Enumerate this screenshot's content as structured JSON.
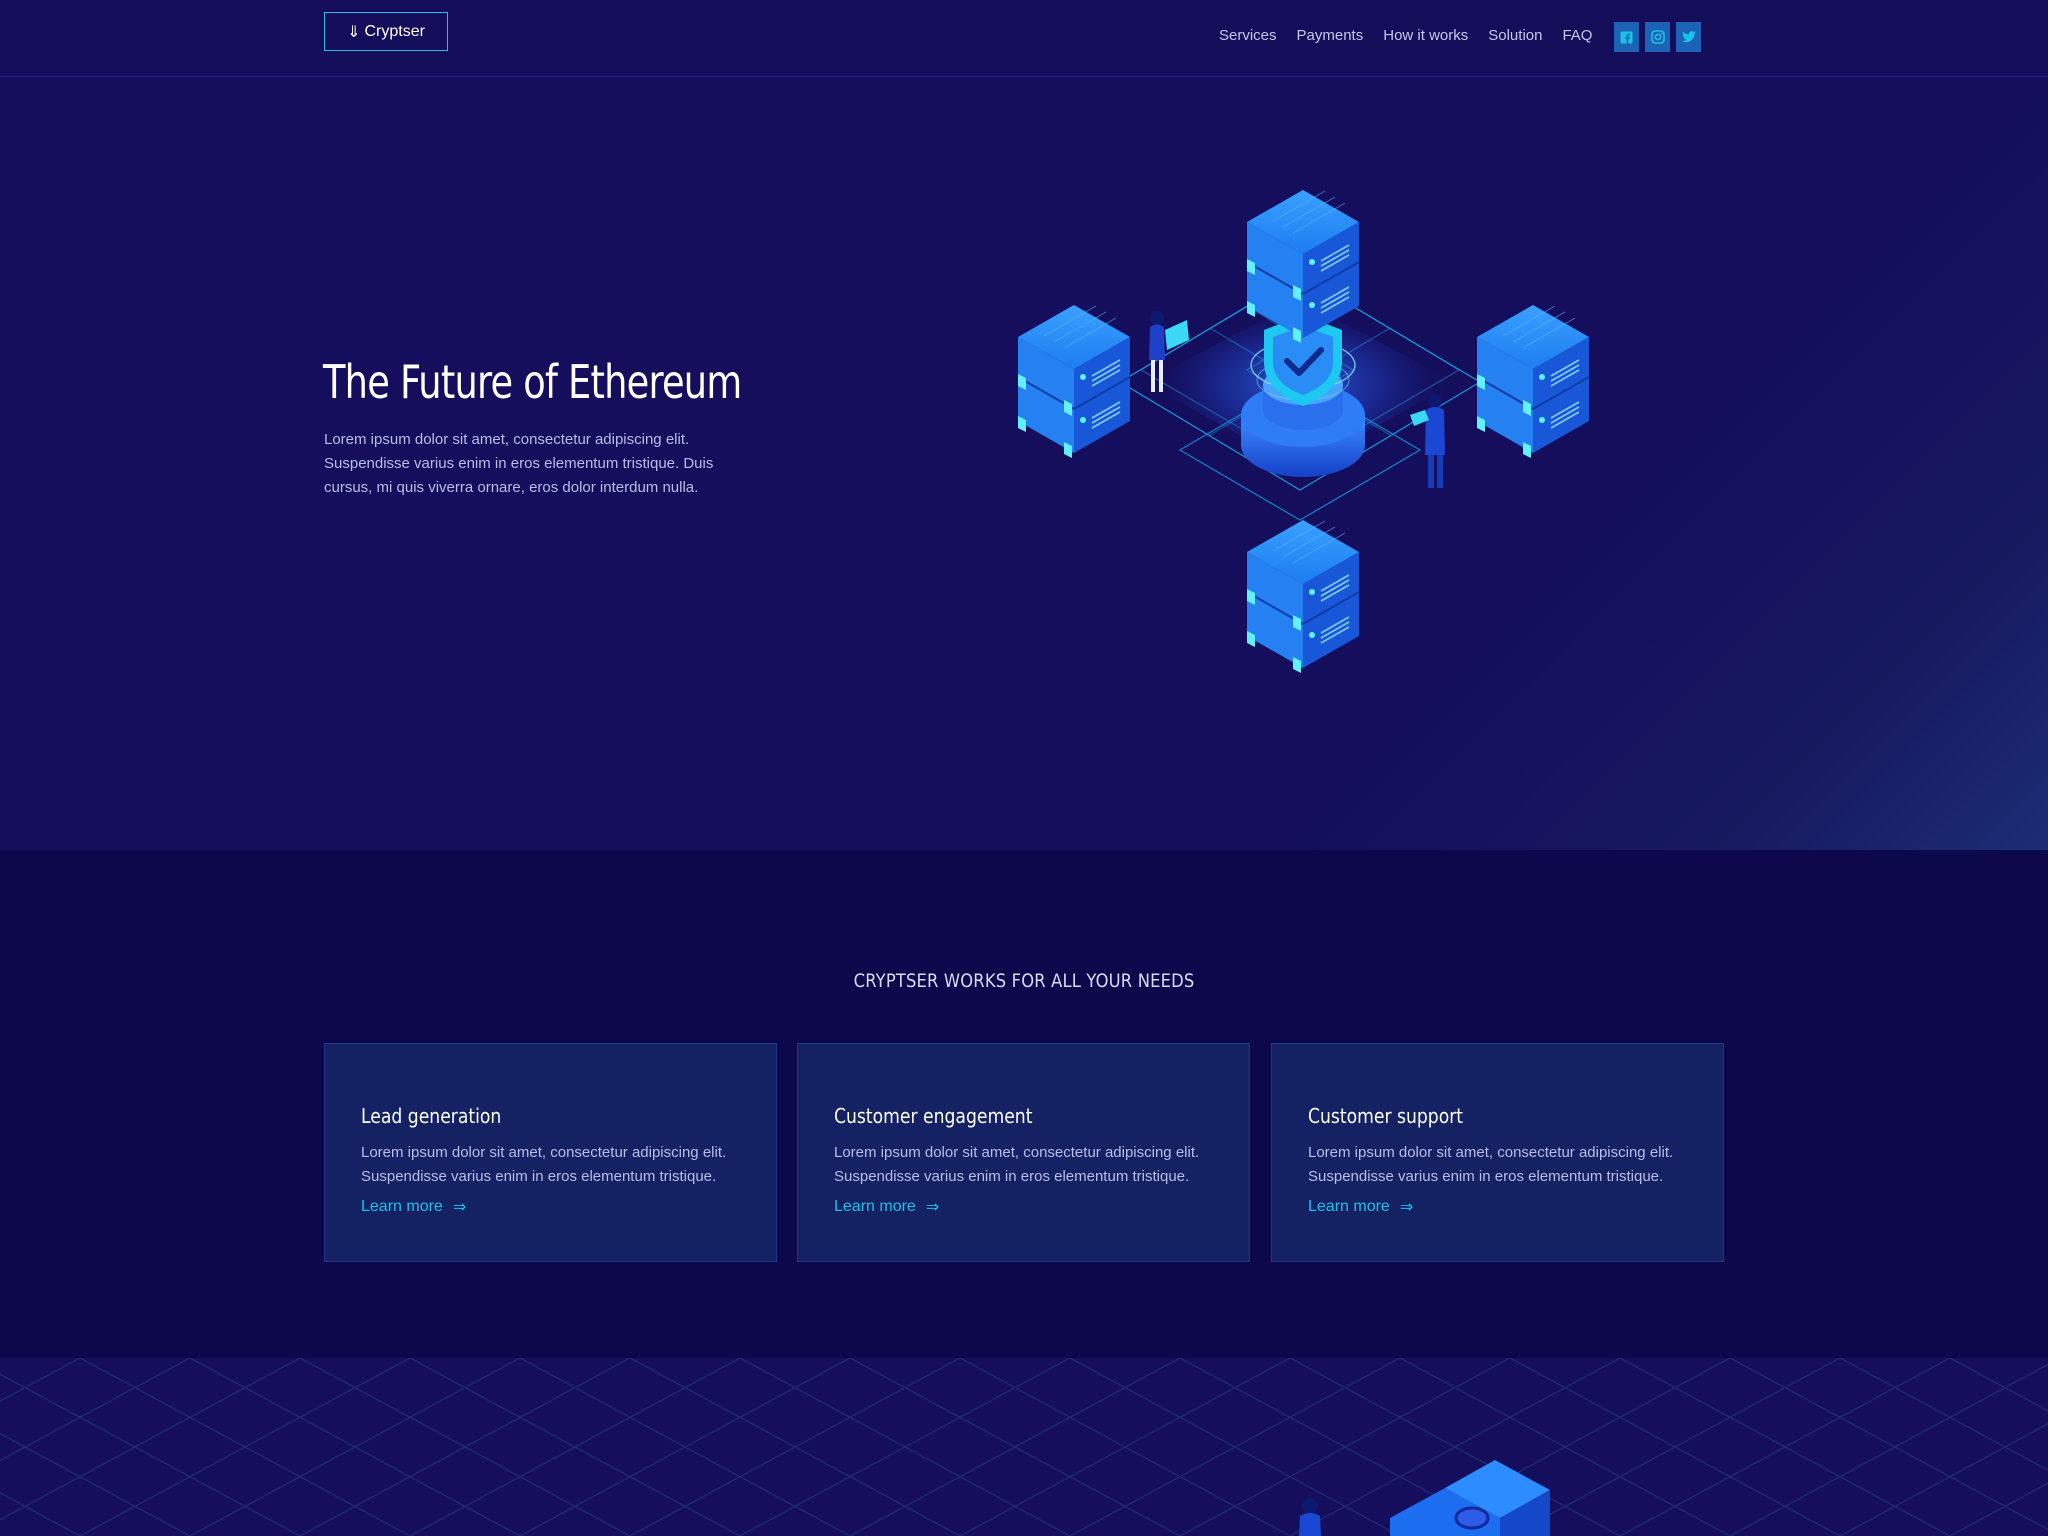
{
  "header": {
    "logo_text": "Cryptser",
    "logo_icon": "down-arrow-icon",
    "nav": [
      "Services",
      "Payments",
      "How it works",
      "Solution",
      "FAQ"
    ],
    "social": [
      "facebook-icon",
      "instagram-icon",
      "twitter-icon"
    ]
  },
  "hero": {
    "title": "The Future of Ethereum",
    "text": "Lorem ipsum dolor sit amet, consectetur adipiscing elit. Suspendisse varius enim in eros elementum tristique. Duis cursus, mi quis viverra ornare, eros dolor interdum nulla."
  },
  "features": {
    "heading": "CRYPTSER WORKS FOR ALL YOUR NEEDS",
    "cards": [
      {
        "title": "Lead generation",
        "text": "Lorem ipsum dolor sit amet, consectetur adipiscing elit. Suspendisse varius enim in eros elementum tristique.",
        "link": "Learn more"
      },
      {
        "title": "Customer engagement",
        "text": "Lorem ipsum dolor sit amet, consectetur adipiscing elit. Suspendisse varius enim in eros elementum tristique.",
        "link": "Learn more"
      },
      {
        "title": "Customer support",
        "text": "Lorem ipsum dolor sit amet, consectetur adipiscing elit. Suspendisse varius enim in eros elementum tristique.",
        "link": "Learn more"
      }
    ]
  },
  "colors": {
    "background": "#130d5a",
    "section_dark": "#0d084b",
    "card": "#142264",
    "accent": "#19c3e6",
    "server_blue": "#1d7df0"
  }
}
